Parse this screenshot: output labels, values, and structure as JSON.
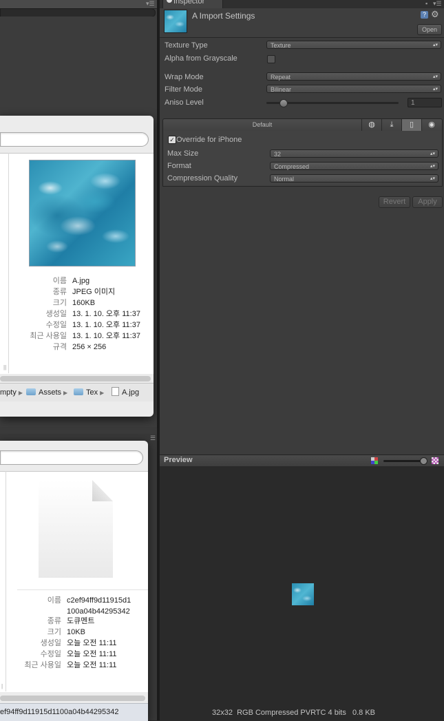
{
  "finder1": {
    "filename": "A.jpg",
    "info": [
      {
        "label": "이름",
        "value": "A.jpg"
      },
      {
        "label": "종류",
        "value": "JPEG 이미지"
      },
      {
        "label": "크기",
        "value": "160KB"
      },
      {
        "label": "생성일",
        "value": "13. 1. 10. 오후 11:37"
      },
      {
        "label": "수정일",
        "value": "13. 1. 10. 오후 11:37"
      },
      {
        "label": "최근 사용일",
        "value": "13. 1. 10. 오후 11:37"
      },
      {
        "label": "규격",
        "value": "256 × 256"
      }
    ],
    "path": [
      "mpty",
      "Assets",
      "Tex",
      "A.jpg"
    ]
  },
  "finder2": {
    "info": [
      {
        "label": "이름",
        "value": "c2ef94ff9d11915d1\n100a04b44295342"
      },
      {
        "label": "종류",
        "value": "도큐멘트"
      },
      {
        "label": "크기",
        "value": "10KB"
      },
      {
        "label": "생성일",
        "value": "오늘 오전 11:11"
      },
      {
        "label": "수정일",
        "value": "오늘 오전 11:11"
      },
      {
        "label": "최근 사용일",
        "value": "오늘 오전 11:11"
      }
    ],
    "path_selected": "ef94ff9d11915d1100a04b44295342"
  },
  "inspector": {
    "tab_label": "Inspector",
    "title": "A Import Settings",
    "open_button": "Open",
    "texture_type": {
      "label": "Texture Type",
      "value": "Texture"
    },
    "alpha_from_grayscale": {
      "label": "Alpha from Grayscale",
      "checked": false
    },
    "wrap_mode": {
      "label": "Wrap Mode",
      "value": "Repeat"
    },
    "filter_mode": {
      "label": "Filter Mode",
      "value": "Bilinear"
    },
    "aniso_level": {
      "label": "Aniso Level",
      "value": "1"
    },
    "platform": {
      "default_label": "Default",
      "icons": [
        "globe-icon",
        "download-icon",
        "iphone-icon",
        "flash-icon"
      ],
      "selected": "iphone-icon",
      "override_label": "Override for iPhone",
      "override_checked": true,
      "max_size": {
        "label": "Max Size",
        "value": "32"
      },
      "format": {
        "label": "Format",
        "value": "Compressed"
      },
      "compression_quality": {
        "label": "Compression Quality",
        "value": "Normal"
      }
    },
    "revert_button": "Revert",
    "apply_button": "Apply"
  },
  "preview": {
    "title": "Preview",
    "info": "32x32  RGB Compressed PVRTC 4 bits   0.8 KB"
  },
  "colors": {
    "panel_bg": "#3c3c3c",
    "finder_bg": "#ececec",
    "selection_bg": "#dfe3ea"
  }
}
